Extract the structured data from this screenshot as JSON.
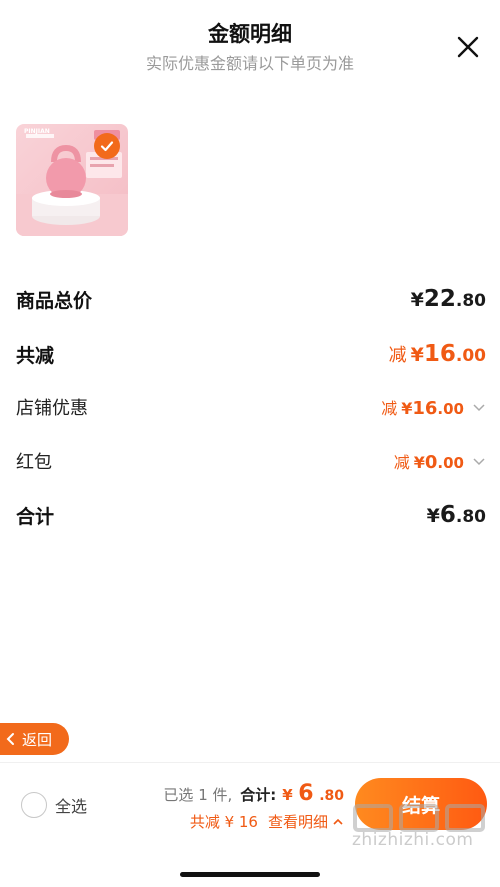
{
  "header": {
    "title": "金额明细",
    "subtitle": "实际优惠金额请以下单页为准"
  },
  "product": {
    "thumb_brand": "PINJIAN",
    "selected": true
  },
  "rows": {
    "goods_total": {
      "label": "商品总价",
      "yen": "¥",
      "int": "22",
      "dec": ".80"
    },
    "total_reduce": {
      "label": "共减",
      "prefix": "减",
      "yen": "¥",
      "int": "16",
      "dec": ".00"
    },
    "store_discount": {
      "label": "店铺优惠",
      "prefix": "减",
      "yen": "¥",
      "int": "16",
      "dec": ".00"
    },
    "red_packet": {
      "label": "红包",
      "prefix": "减",
      "yen": "¥",
      "int": "0",
      "dec": ".00"
    },
    "sum": {
      "label": "合计",
      "yen": "¥",
      "int": "6",
      "dec": ".80"
    }
  },
  "back_button": {
    "label": "返回"
  },
  "bottom_bar": {
    "select_all_label": "全选",
    "selected_count": "已选 1 件,",
    "total_label": "合计:",
    "total_yen": "¥",
    "total_int": "6",
    "total_dec": ".80",
    "reduce_text": "共减 ¥ 16",
    "detail_link": "查看明细",
    "checkout_label": "结算"
  },
  "watermark": {
    "text": "zhizhizhi.com"
  },
  "colors": {
    "accent": "#f05a14",
    "button_gradient_start": "#ff8a1f",
    "button_gradient_end": "#ff5a12",
    "subtitle": "#9a9a9a"
  },
  "icons": {
    "close": "close-icon",
    "check": "check-icon",
    "chevron_down": "chevron-down-icon",
    "chevron_up": "chevron-up-icon",
    "chevron_left": "chevron-left-icon"
  }
}
